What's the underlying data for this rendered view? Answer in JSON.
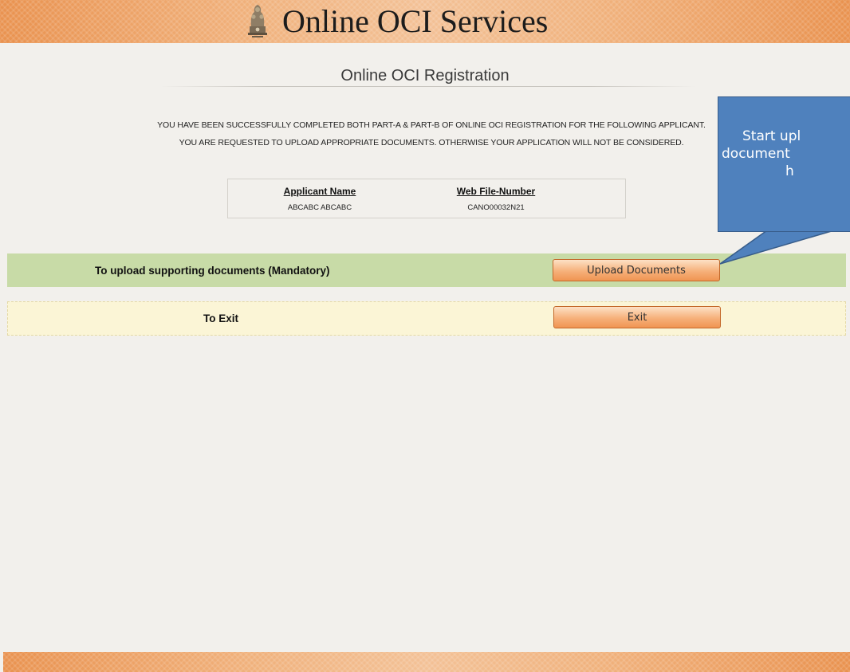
{
  "header": {
    "title": "Online OCI Services",
    "emblem_icon": "national-emblem-icon"
  },
  "page": {
    "title": "Online OCI Registration",
    "message_line_1": "YOU HAVE BEEN SUCCESSFULLY COMPLETED BOTH PART-A & PART-B OF ONLINE OCI REGISTRATION FOR THE FOLLOWING APPLICANT.",
    "message_line_2": "YOU ARE REQUESTED TO UPLOAD APPROPRIATE DOCUMENTS. OTHERWISE YOUR APPLICATION WILL NOT BE CONSIDERED."
  },
  "applicant_table": {
    "headers": [
      "Applicant Name",
      "Web File-Number"
    ],
    "rows": [
      [
        "ABCABC ABCABC",
        "CANO00032N21"
      ]
    ]
  },
  "actions": {
    "upload_label": "To upload supporting documents (Mandatory)",
    "upload_button": "Upload Documents",
    "exit_label": "To Exit",
    "exit_button": "Exit"
  },
  "callout": {
    "line_1": "Start upl",
    "line_2": "document",
    "line_3": "h"
  },
  "colors": {
    "banner": "#ef9f5f",
    "upload_row": "#c8dba7",
    "exit_row": "#fbf5d6",
    "button": "#f6b07a",
    "callout": "#4f81bd"
  }
}
